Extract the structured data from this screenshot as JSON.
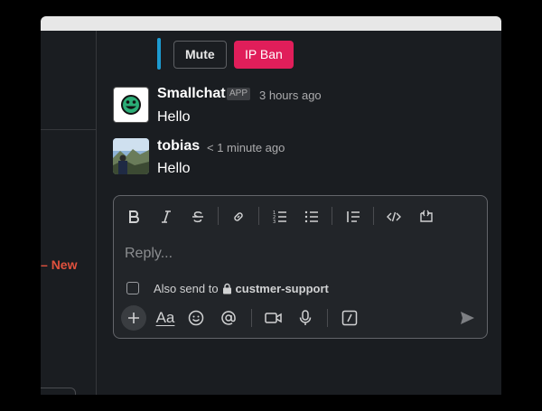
{
  "side": {
    "new_label": "New"
  },
  "actions": {
    "mute_label": "Mute",
    "ban_label": "IP Ban"
  },
  "messages": [
    {
      "author": "Smallchat",
      "badge": "APP",
      "time": "3 hours ago",
      "text": "Hello",
      "avatar_icon": "smiley-logo-icon"
    },
    {
      "author": "tobias",
      "time": "< 1 minute ago",
      "text": "Hello",
      "avatar_icon": "user-photo-avatar"
    }
  ],
  "composer": {
    "placeholder": "Reply...",
    "also_send_prefix": "Also send to",
    "channel": "custmer-support",
    "formatting_icons": [
      "bold-icon",
      "italic-icon",
      "strikethrough-icon",
      "link-icon",
      "ordered-list-icon",
      "bulleted-list-icon",
      "blockquote-icon",
      "code-icon",
      "code-block-icon"
    ],
    "bottom_icons": [
      "plus-icon",
      "text-format-icon",
      "emoji-icon",
      "mention-icon",
      "video-icon",
      "microphone-icon",
      "slash-command-icon",
      "send-icon"
    ],
    "text_format_label": "Aa"
  },
  "colors": {
    "background": "#1a1d21",
    "accent_blue": "#1d9bd1",
    "ban_red": "#e01e5a",
    "new_marker": "#e0513d",
    "smiley_green": "#2bac76"
  }
}
